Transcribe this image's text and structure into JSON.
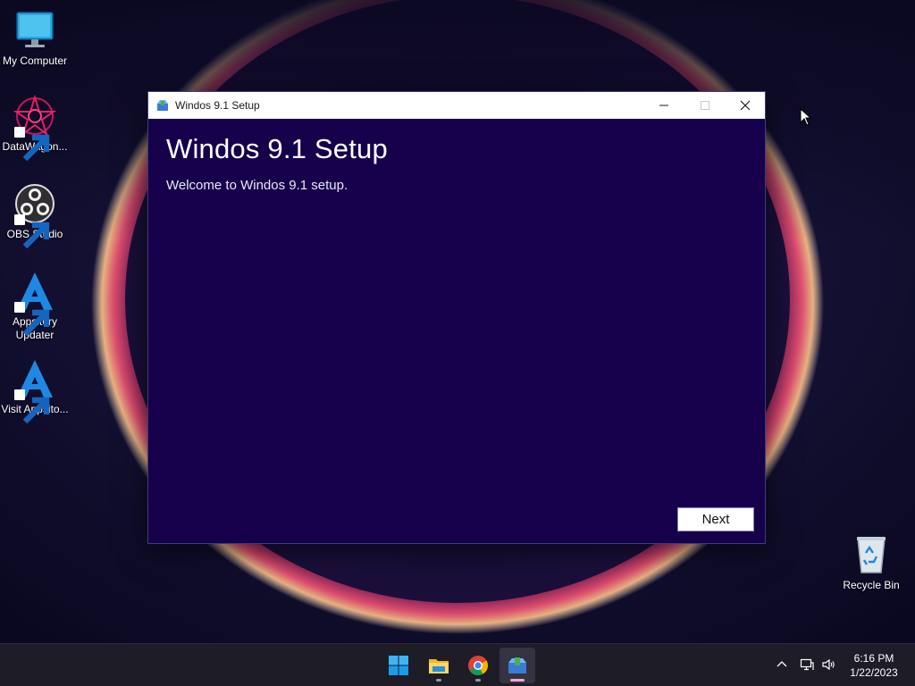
{
  "desktop": {
    "icons": [
      {
        "label": "My Computer"
      },
      {
        "label": "DataWagon..."
      },
      {
        "label": "OBS Studio"
      },
      {
        "label": "Appsitory Updater"
      },
      {
        "label": "Visit Appsito..."
      },
      {
        "label": "Recycle Bin"
      }
    ]
  },
  "window": {
    "title": "Windos 9.1 Setup",
    "heading": "Windos 9.1 Setup",
    "welcome": "Welcome to Windos 9.1 setup.",
    "next_label": "Next",
    "icon": "setup-app-icon"
  },
  "taskbar": {
    "apps": [
      {
        "name": "start",
        "icon": "windows-logo-icon"
      },
      {
        "name": "file-explorer",
        "icon": "folder-icon"
      },
      {
        "name": "chrome",
        "icon": "chrome-icon"
      },
      {
        "name": "setup",
        "icon": "setup-app-icon",
        "active": true
      }
    ],
    "tray": {
      "icons": [
        "chevron-up-icon",
        "network-icon",
        "volume-icon"
      ]
    },
    "clock": {
      "time": "6:16 PM",
      "date": "1/22/2023"
    }
  },
  "colors": {
    "window_bg": "#17004b",
    "taskbar_bg": "#1e1c27",
    "active_indicator": "#f0a7d3"
  }
}
